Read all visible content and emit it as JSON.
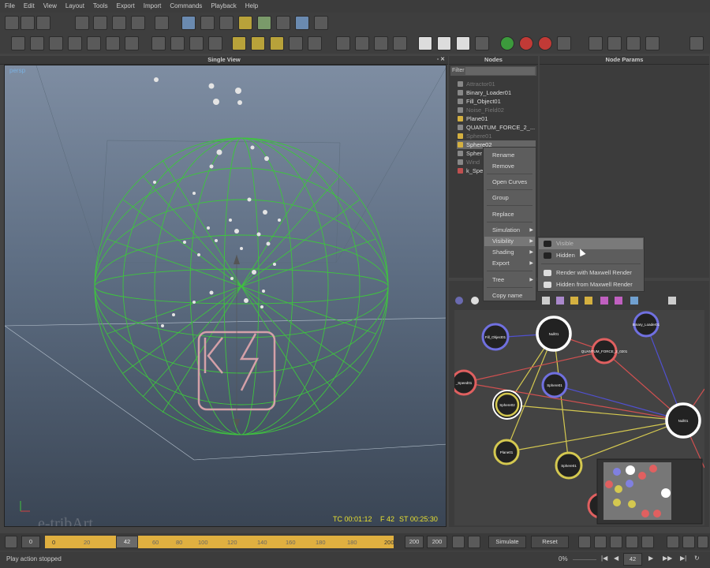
{
  "menu": [
    "File",
    "Edit",
    "View",
    "Layout",
    "Tools",
    "Export",
    "Import",
    "Commands",
    "Playback",
    "Help"
  ],
  "viewport": {
    "title": "Single View",
    "camera": "persp",
    "hud": {
      "tc": "TC 00:01:12",
      "frame": "F 42",
      "st": "ST 00:25:30"
    },
    "watermark": "e-tribArt"
  },
  "nodes_panel": {
    "title": "Nodes",
    "filter_label": "Filter",
    "items": [
      {
        "label": "Attractor01",
        "dim": true
      },
      {
        "label": "Binary_Loader01",
        "dim": false
      },
      {
        "label": "Fill_Object01",
        "dim": false
      },
      {
        "label": "Noise_Field02",
        "dim": true
      },
      {
        "label": "Plane01",
        "dim": false
      },
      {
        "label": "QUANTUM_FORCE_2_...",
        "dim": false
      },
      {
        "label": "Sphere01",
        "dim": true
      },
      {
        "label": "Sphere02",
        "dim": false,
        "selected": true
      },
      {
        "label": "Spher",
        "dim": false
      },
      {
        "label": "Wind",
        "dim": true
      },
      {
        "label": "k_Spe",
        "dim": false
      }
    ]
  },
  "params_panel": {
    "title": "Node Params"
  },
  "context_menu": {
    "items": [
      "Rename",
      "Remove",
      "Open Curves",
      "Group",
      "Replace",
      "Simulation",
      "Visibility",
      "Shading",
      "Export",
      "Tree",
      "Copy name"
    ]
  },
  "visibility_submenu": {
    "items": [
      "Visible",
      "Hidden",
      "Render with Maxwell Render",
      "Hidden from Maxwell Render"
    ]
  },
  "graph": {
    "nodes": [
      "Fill_Object01",
      "Null01",
      "Binary_Loader01",
      "QUANTUM_FORCE_2_0201",
      "_Speed01",
      "Sphere02",
      "Sphere01",
      "Null01",
      "Plane01",
      "Sphere01"
    ]
  },
  "timeline": {
    "start": "0",
    "range_start": "0",
    "current": "42",
    "ticks": [
      "20",
      "40",
      "60",
      "80",
      "100",
      "120",
      "140",
      "160",
      "180",
      "200"
    ],
    "end1": "200",
    "end2": "200",
    "simulate": "Simulate",
    "reset": "Reset",
    "frame_field": "42"
  },
  "status": {
    "text": "Play action stopped",
    "percent": "0%"
  }
}
